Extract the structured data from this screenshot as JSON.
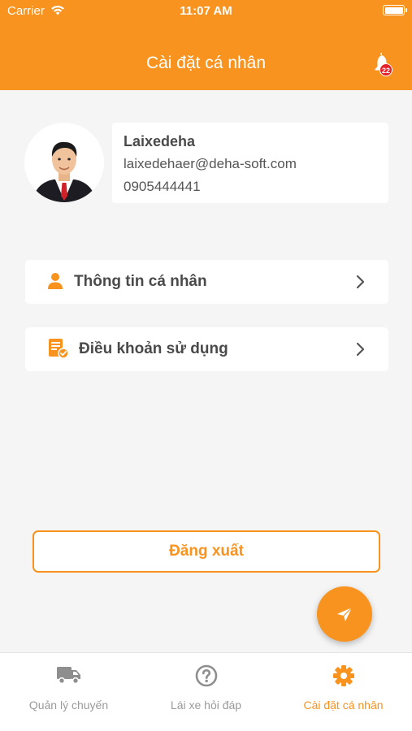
{
  "status_bar": {
    "carrier": "Carrier",
    "time": "11:07 AM"
  },
  "header": {
    "title": "Cài đặt cá nhân",
    "notification_count": "22"
  },
  "profile": {
    "name": "Laixedeha",
    "email": "laixedehaer@deha-soft.com",
    "phone": "0905444441"
  },
  "menu": {
    "personal_info": "Thông tin cá nhân",
    "terms": "Điều khoản sử dụng"
  },
  "logout_label": "Đăng xuất",
  "tabs": [
    {
      "label": "Quản lý chuyến",
      "icon": "truck-icon"
    },
    {
      "label": "Lái xe hỏi đáp",
      "icon": "question-icon"
    },
    {
      "label": "Cài đặt cá nhân",
      "icon": "gear-icon"
    }
  ],
  "colors": {
    "accent": "#f7931e",
    "badge": "#e4202a",
    "background": "#f5f5f5"
  }
}
